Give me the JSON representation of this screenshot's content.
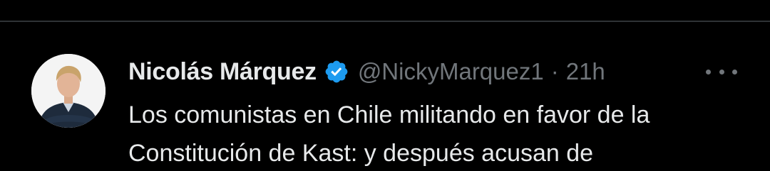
{
  "tweet": {
    "display_name": "Nicolás Márquez",
    "handle": "@NickyMarquez1",
    "separator": "·",
    "time": "21h",
    "text_lines": [
      "Los comunistas en Chile militando en favor de la",
      "Constitución de Kast: y después acusan de"
    ]
  },
  "icons": {
    "verified": "verified-badge-icon",
    "more": "more-horizontal-icon"
  },
  "colors": {
    "background": "#000000",
    "primary_text": "#e7e9ea",
    "secondary_text": "#71767b",
    "verified_blue": "#1d9bf0",
    "divider": "#2f3336"
  }
}
